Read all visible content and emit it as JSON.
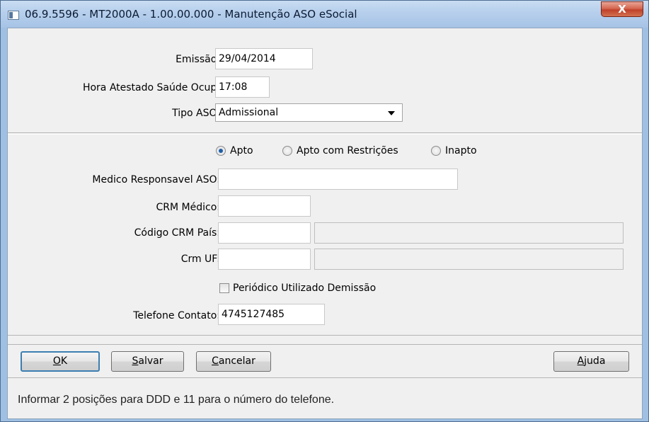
{
  "window": {
    "title": "06.9.5596 - MT2000A - 1.00.00.000 - Manutenção ASO eSocial",
    "close_label": "X"
  },
  "top_panel": {
    "emissao_label": "Emissão:",
    "emissao_value": "29/04/2014",
    "hora_label": "Hora Atestado Saúde Ocup:",
    "hora_value": "17:08",
    "tipo_label": "Tipo ASO:",
    "tipo_value": "Admissional"
  },
  "result": {
    "options": [
      {
        "label": "Apto",
        "selected": true
      },
      {
        "label": "Apto com Restrições",
        "selected": false
      },
      {
        "label": "Inapto",
        "selected": false
      }
    ]
  },
  "form": {
    "medico_label": "Medico Responsavel ASO:",
    "medico_value": "",
    "crm_label": "CRM Médico:",
    "crm_value": "",
    "codigo_crm_label": "Código CRM País:",
    "codigo_crm_value": "",
    "codigo_crm_desc": "",
    "crm_uf_label": "Crm UF:",
    "crm_uf_value": "",
    "crm_uf_desc": "",
    "periodico_label": "Periódico Utilizado Demissão",
    "periodico_checked": false,
    "telefone_label": "Telefone Contato:",
    "telefone_value": "4745127485"
  },
  "buttons": {
    "ok": {
      "accel": "O",
      "rest": "K"
    },
    "salvar": {
      "accel": "S",
      "rest": "alvar"
    },
    "cancelar": {
      "accel": "C",
      "rest": "ancelar"
    },
    "ajuda": {
      "accel": "A",
      "rest": "juda"
    }
  },
  "status": {
    "message": "Informar 2 posições para DDD e 11 para o número do telefone."
  }
}
